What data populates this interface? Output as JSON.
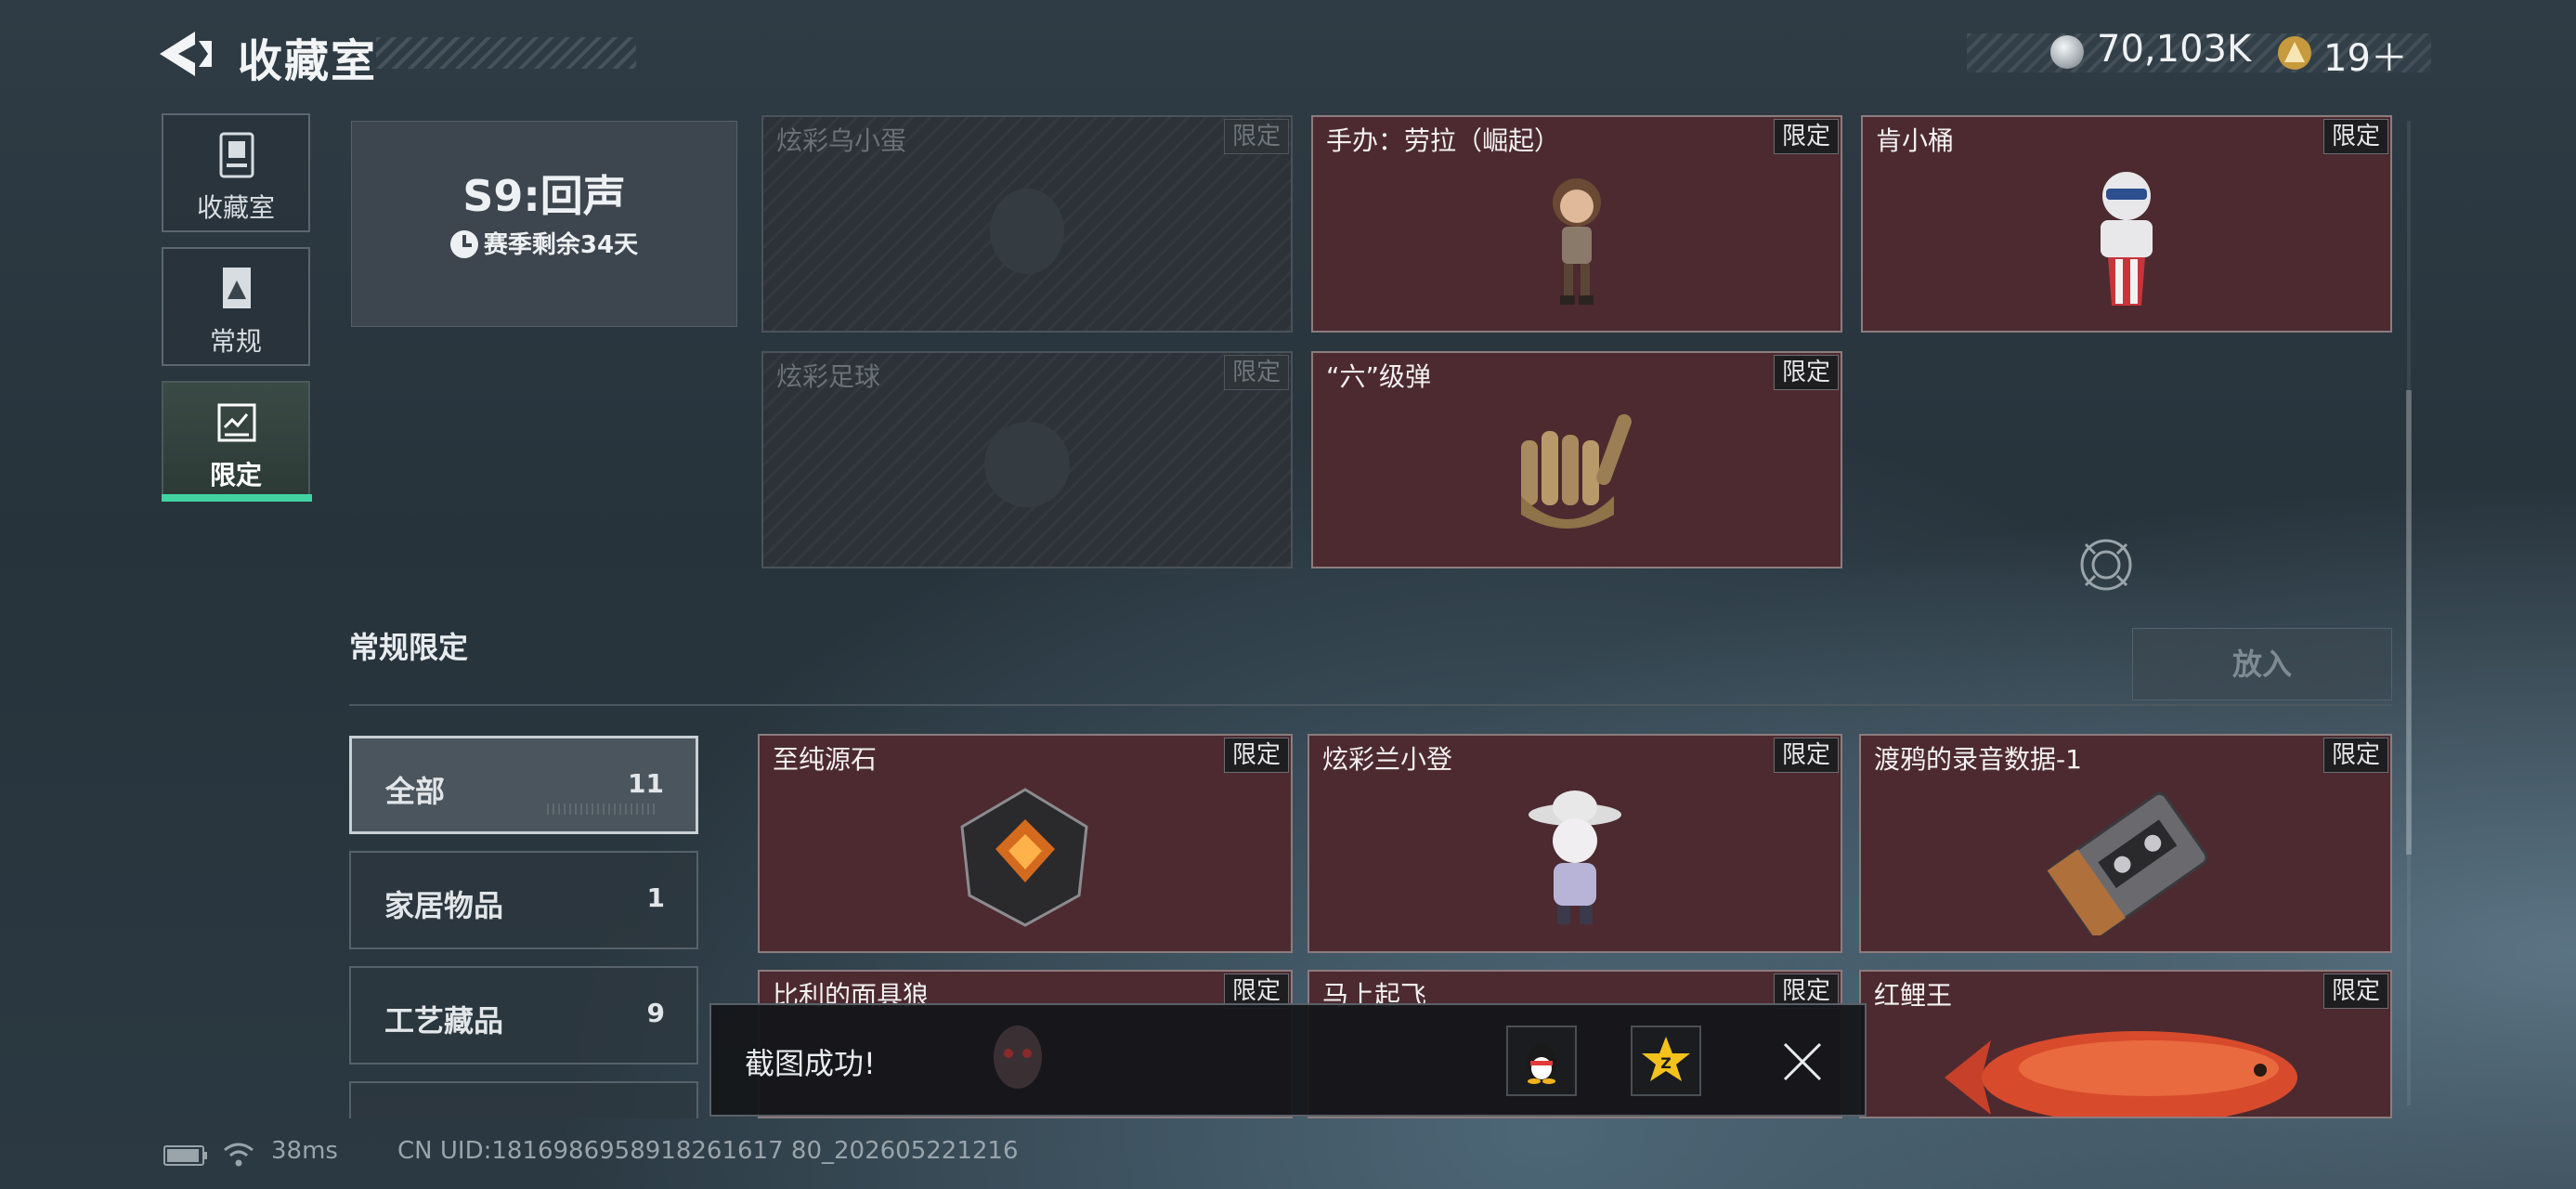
{
  "header": {
    "title": "收藏室",
    "currency_primary": "70,103K",
    "currency_secondary": "19＋"
  },
  "sidebar": {
    "items": [
      {
        "label": "收藏室",
        "icon": "cabinet-icon"
      },
      {
        "label": "常规",
        "icon": "document-icon"
      },
      {
        "label": "限定",
        "icon": "limited-icon"
      }
    ],
    "active_index": 2,
    "accent_color": "#41d3a0"
  },
  "season": {
    "title": "S9:回声",
    "remaining": "赛季剩余34天"
  },
  "season_items": [
    {
      "name": "炫彩乌小蛋",
      "tag": "限定",
      "locked": true
    },
    {
      "name": "手办：劳拉（崛起）",
      "tag": "限定",
      "locked": false
    },
    {
      "name": "肯小桶",
      "tag": "限定",
      "locked": false
    },
    {
      "name": "炫彩足球",
      "tag": "限定",
      "locked": true
    },
    {
      "name": "“六”级弹",
      "tag": "限定",
      "locked": false
    }
  ],
  "section": {
    "title": "常规限定",
    "place_button": "放入"
  },
  "filters": [
    {
      "label": "全部",
      "count": "11"
    },
    {
      "label": "家居物品",
      "count": "1"
    },
    {
      "label": "工艺藏品",
      "count": "9"
    }
  ],
  "regular_items": [
    {
      "name": "至纯源石",
      "tag": "限定"
    },
    {
      "name": "炫彩兰小登",
      "tag": "限定"
    },
    {
      "name": "渡鸦的录音数据-1",
      "tag": "限定"
    },
    {
      "name": "比利的面具狼",
      "tag": "限定"
    },
    {
      "name": "马上起飞",
      "tag": "限定"
    },
    {
      "name": "红鲤王",
      "tag": "限定"
    }
  ],
  "toast": {
    "message": "截图成功!"
  },
  "footer": {
    "ping": "38ms",
    "uid": "CN UID:1816986958918261617 80_202605221216"
  },
  "colors": {
    "card_bg": "#4c2a30",
    "accent": "#41d3a0"
  }
}
